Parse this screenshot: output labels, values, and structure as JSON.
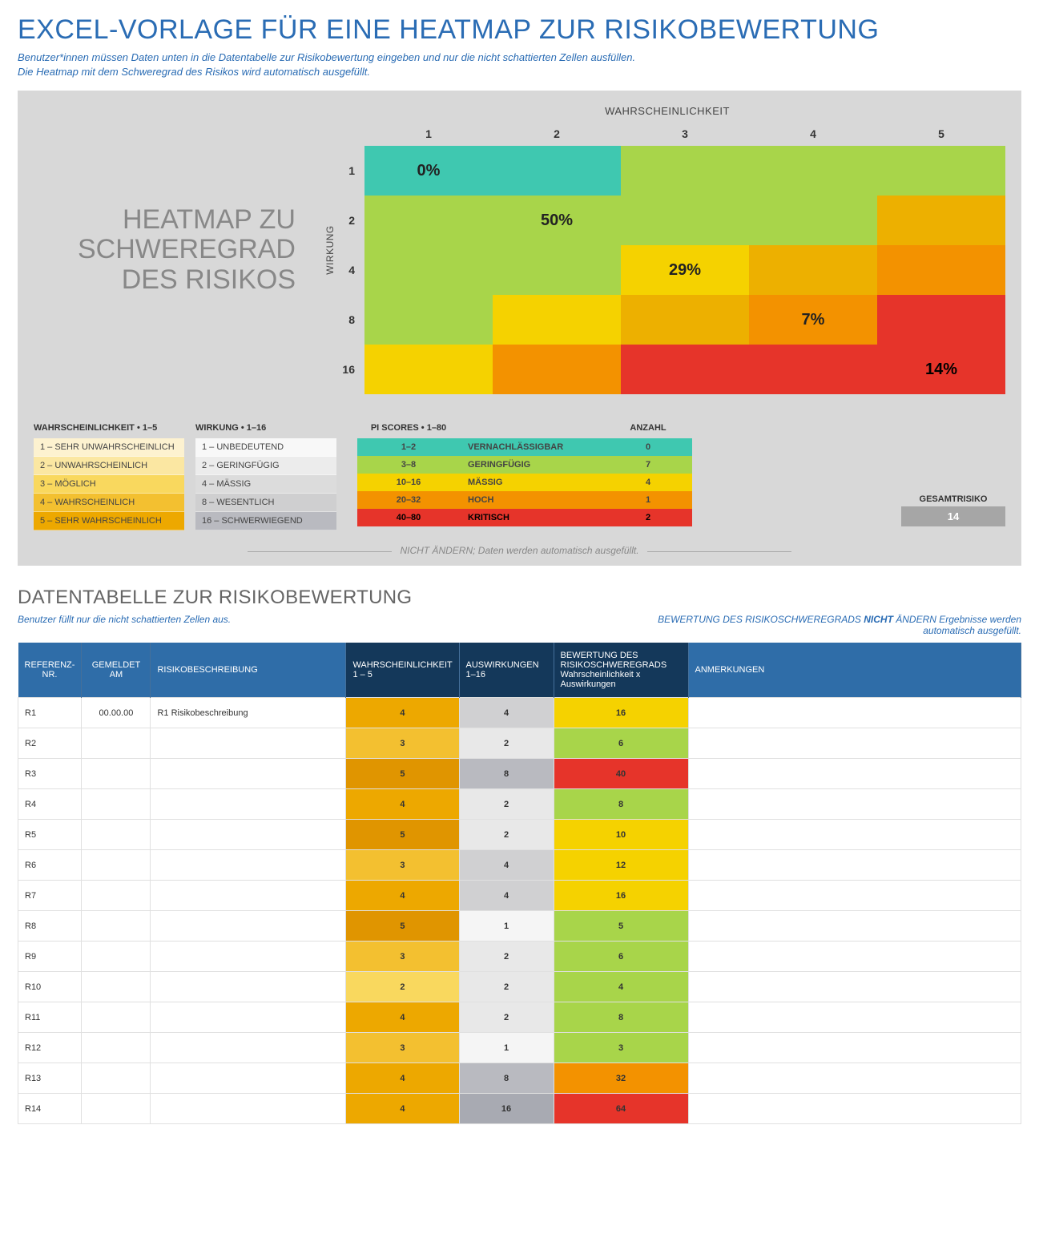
{
  "title": "EXCEL-VORLAGE FÜR EINE HEATMAP ZUR RISIKOBEWERTUNG",
  "intro_line1": "Benutzer*innen müssen Daten unten in die Datentabelle zur Risikobewertung eingeben und nur die nicht schattierten Zellen ausfüllen.",
  "intro_line2": "Die Heatmap mit dem Schweregrad des Risikos wird automatisch ausgefüllt.",
  "heatmap": {
    "title_ln1": "HEATMAP ZU",
    "title_ln2": "SCHWEREGRAD",
    "title_ln3": "DES RISIKOS",
    "xlabel": "WAHRSCHEINLICHKEIT",
    "ylabel": "WIRKUNG",
    "col_heads": [
      "1",
      "2",
      "3",
      "4",
      "5"
    ],
    "row_heads": [
      "1",
      "2",
      "4",
      "8",
      "16"
    ],
    "percent": {
      "r0c0": "0%",
      "r1c1": "50%",
      "r2c2": "29%",
      "r3c3": "7%",
      "r4c4": "14%"
    }
  },
  "legend": {
    "wahr_head": "WAHRSCHEINLICHKEIT  •  1–5",
    "wirk_head": "WIRKUNG  •  1–16",
    "wahr": [
      "1 – SEHR UNWAHRSCHEINLICH",
      "2 – UNWAHRSCHEINLICH",
      "3 – MÖGLICH",
      "4 – WAHRSCHEINLICH",
      "5 – SEHR WAHRSCHEINLICH"
    ],
    "wirk": [
      "1 – UNBEDEUTEND",
      "2 – GERINGFÜGIG",
      "4 – MÄSSIG",
      "8 – WESENTLICH",
      "16 – SCHWERWIEGEND"
    ],
    "pi_head": "PI SCORES  •  1–80",
    "anzahl_head": "ANZAHL",
    "pi": [
      {
        "range": "1–2",
        "label": "VERNACHLÄSSIGBAR",
        "count": "0",
        "cls": "c-teal"
      },
      {
        "range": "3–8",
        "label": "GERINGFÜGIG",
        "count": "7",
        "cls": "c-lime"
      },
      {
        "range": "10–16",
        "label": "MÄSSIG",
        "count": "4",
        "cls": "c-yellow"
      },
      {
        "range": "20–32",
        "label": "HOCH",
        "count": "1",
        "cls": "c-orange"
      },
      {
        "range": "40–80",
        "label": "KRITISCH",
        "count": "2",
        "cls": "c-red"
      }
    ],
    "gesamt_head": "GESAMTRISIKO",
    "gesamt_val": "14",
    "divider_note": "NICHT ÄNDERN; Daten werden automatisch ausgefüllt."
  },
  "table": {
    "heading": "DATENTABELLE ZUR RISIKOBEWERTUNG",
    "intro_left": "Benutzer füllt nur die nicht schattierten Zellen aus.",
    "intro_right_pre": "BEWERTUNG DES RISIKOSCHWEREGRADS ",
    "intro_right_bold": "NICHT",
    "intro_right_post": " ÄNDERN  Ergebnisse werden automatisch ausgefüllt.",
    "headers": {
      "ref": "REFERENZ-NR.",
      "date": "GEMELDET AM",
      "desc": "RISIKOBESCHREIBUNG",
      "prob": "WAHRSCHEINLICHKEIT 1 – 5",
      "imp": "AUSWIRKUNGEN 1–16",
      "score": "BEWERTUNG DES RISIKOSCHWEREGRADS Wahrscheinlichkeit x Auswirkungen",
      "notes": "ANMERKUNGEN"
    },
    "rows": [
      {
        "ref": "R1",
        "date": "00.00.00",
        "desc": "R1 Risikobeschreibung",
        "p": 4,
        "i": 4,
        "s": 16,
        "scls": "s-yellow"
      },
      {
        "ref": "R2",
        "date": "",
        "desc": "",
        "p": 3,
        "i": 2,
        "s": 6,
        "scls": "s-lime"
      },
      {
        "ref": "R3",
        "date": "",
        "desc": "",
        "p": 5,
        "i": 8,
        "s": 40,
        "scls": "s-red"
      },
      {
        "ref": "R4",
        "date": "",
        "desc": "",
        "p": 4,
        "i": 2,
        "s": 8,
        "scls": "s-lime"
      },
      {
        "ref": "R5",
        "date": "",
        "desc": "",
        "p": 5,
        "i": 2,
        "s": 10,
        "scls": "s-yellow"
      },
      {
        "ref": "R6",
        "date": "",
        "desc": "",
        "p": 3,
        "i": 4,
        "s": 12,
        "scls": "s-yellow"
      },
      {
        "ref": "R7",
        "date": "",
        "desc": "",
        "p": 4,
        "i": 4,
        "s": 16,
        "scls": "s-yellow"
      },
      {
        "ref": "R8",
        "date": "",
        "desc": "",
        "p": 5,
        "i": 1,
        "s": 5,
        "scls": "s-lime"
      },
      {
        "ref": "R9",
        "date": "",
        "desc": "",
        "p": 3,
        "i": 2,
        "s": 6,
        "scls": "s-lime"
      },
      {
        "ref": "R10",
        "date": "",
        "desc": "",
        "p": 2,
        "i": 2,
        "s": 4,
        "scls": "s-lime"
      },
      {
        "ref": "R11",
        "date": "",
        "desc": "",
        "p": 4,
        "i": 2,
        "s": 8,
        "scls": "s-lime"
      },
      {
        "ref": "R12",
        "date": "",
        "desc": "",
        "p": 3,
        "i": 1,
        "s": 3,
        "scls": "s-lime"
      },
      {
        "ref": "R13",
        "date": "",
        "desc": "",
        "p": 4,
        "i": 8,
        "s": 32,
        "scls": "s-orange"
      },
      {
        "ref": "R14",
        "date": "",
        "desc": "",
        "p": 4,
        "i": 16,
        "s": 64,
        "scls": "s-red"
      }
    ]
  },
  "chart_data": {
    "type": "heatmap",
    "title": "HEATMAP ZU SCHWEREGRAD DES RISIKOS",
    "xlabel": "WAHRSCHEINLICHKEIT",
    "ylabel": "WIRKUNG",
    "x": [
      1,
      2,
      3,
      4,
      5
    ],
    "y": [
      1,
      2,
      4,
      8,
      16
    ],
    "diagonal_percent": {
      "1,1": 0,
      "2,2": 50,
      "3,4": 29,
      "4,8": 7,
      "5,16": 14
    },
    "color_scale": [
      "VERNACHLÄSSIGBAR",
      "GERINGFÜGIG",
      "MÄSSIG",
      "HOCH",
      "KRITISCH"
    ],
    "color_ranges": {
      "1-2": "teal",
      "3-8": "lime",
      "10-16": "yellow",
      "20-32": "orange",
      "40-80": "red"
    }
  }
}
